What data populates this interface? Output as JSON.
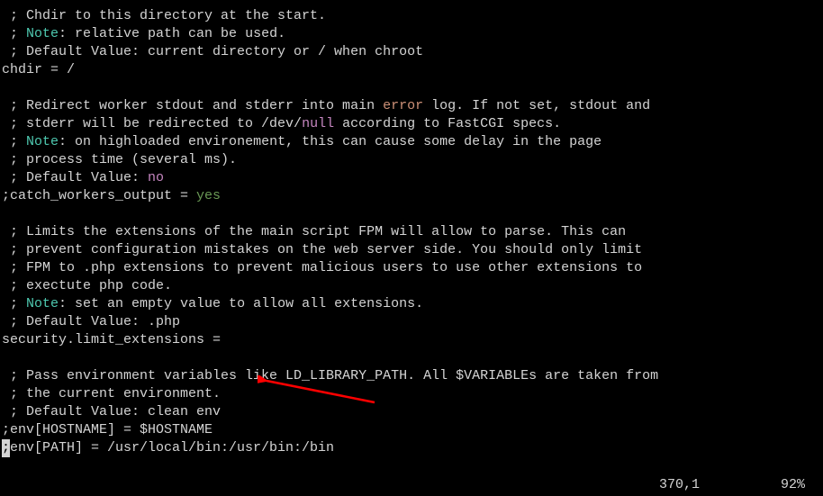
{
  "lines": {
    "l1_a": " ; Chdir to this directory at the start.",
    "l2_a": " ; ",
    "l2_note": "Note",
    "l2_b": ": relative path can be used.",
    "l3_a": " ; Default Value: current directory or / when chroot",
    "l4": "chdir = /",
    "l5": "",
    "l6_a": " ; Redirect worker stdout and stderr into main ",
    "l6_err": "error",
    "l6_b": " log. If not set, stdout and",
    "l7_a": " ; stderr will be redirected to /dev/",
    "l7_null": "null",
    "l7_b": " according to FastCGI specs.",
    "l8_a": " ; ",
    "l8_note": "Note",
    "l8_b": ": on highloaded environement, this can cause some delay in the page",
    "l9": " ; process time (several ms).",
    "l10_a": " ; Default Value: ",
    "l10_no": "no",
    "l11_a": ";catch_workers_output = ",
    "l11_yes": "yes",
    "l12": "",
    "l13": " ; Limits the extensions of the main script FPM will allow to parse. This can",
    "l14": " ; prevent configuration mistakes on the web server side. You should only limit",
    "l15": " ; FPM to .php extensions to prevent malicious users to use other extensions to",
    "l16": " ; exectute php code.",
    "l17_a": " ; ",
    "l17_note": "Note",
    "l17_b": ": set an empty value to allow all extensions.",
    "l18": " ; Default Value: .php",
    "l19": "security.limit_extensions =",
    "l20": "",
    "l21": " ; Pass environment variables like LD_LIBRARY_PATH. All $VARIABLEs are taken from",
    "l22": " ; the current environment.",
    "l23": " ; Default Value: clean env",
    "l24": ";env[HOSTNAME] = $HOSTNAME",
    "l25_a": "env[PATH] = /usr/local/bin:/usr/bin:/bin"
  },
  "status": {
    "position": "370,1",
    "percent": "92%"
  },
  "cursor_char": ";"
}
